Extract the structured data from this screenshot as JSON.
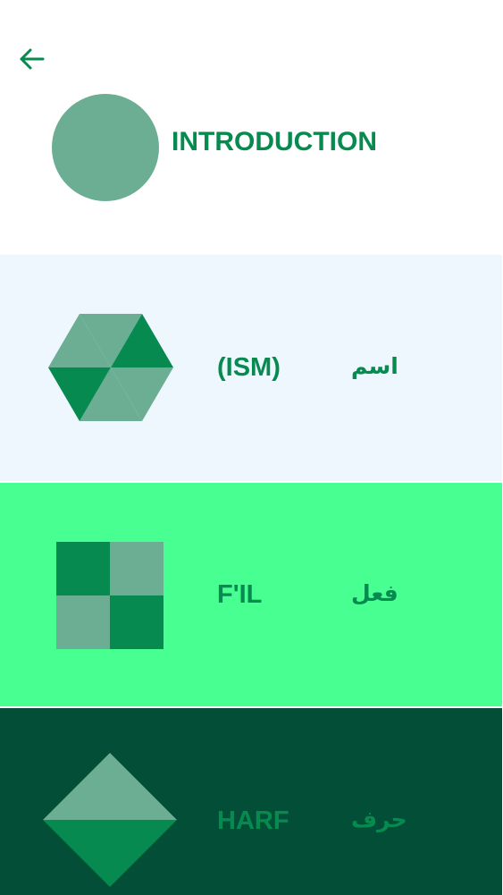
{
  "header": {
    "back_icon": "arrow-left-icon",
    "title": "INTRODUCTION",
    "circle_color": "#6cae94",
    "accent_color": "#078a4f"
  },
  "cards": [
    {
      "latin": "(ISM)",
      "arabic": "اسم",
      "icon": "hexagon-icon",
      "background": "#eff7fe"
    },
    {
      "latin": "F'IL",
      "arabic": "فعل",
      "icon": "checker-square-icon",
      "background": "#48ff92"
    },
    {
      "latin": "HARF",
      "arabic": "حرف",
      "icon": "diamond-icon",
      "background": "#034e37"
    }
  ]
}
